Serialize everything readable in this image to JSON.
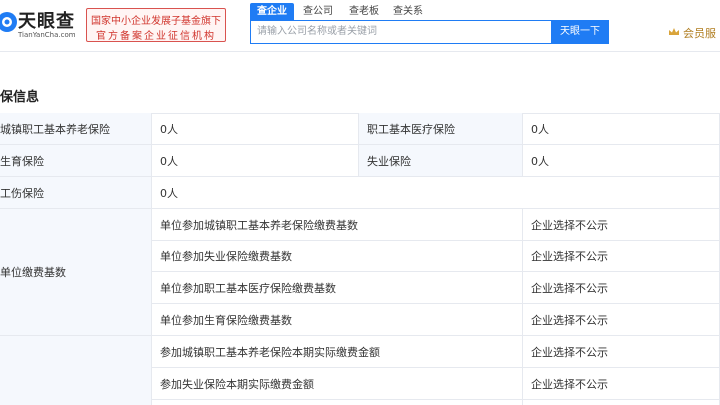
{
  "header": {
    "logo_text": "天眼查",
    "logo_subtext": "TianYanCha.com",
    "badge_line1": "国家中小企业发展子基金旗下",
    "badge_line2": "官方备案企业征信机构",
    "tabs": [
      "查企业",
      "查公司",
      "查老板",
      "查关系"
    ],
    "search_placeholder": "请输入公司名称或者关键词",
    "search_button": "天眼一下",
    "vip_label": "会员服",
    "accent_color": "#1f7cf4",
    "badge_color": "#d0342c"
  },
  "section": {
    "title": "保信息"
  },
  "table": {
    "row1": {
      "label1": "城镇职工基本养老保险",
      "value1": "0人",
      "label2": "职工基本医疗保险",
      "value2": "0人"
    },
    "row2": {
      "label1": "生育保险",
      "value1": "0人",
      "label2": "失业保险",
      "value2": "0人"
    },
    "row3": {
      "label1": "工伤保险",
      "value1": "0人"
    },
    "group1": {
      "label": "单位缴费基数",
      "items": [
        {
          "name": "单位参加城镇职工基本养老保险缴费基数",
          "value": "企业选择不公示"
        },
        {
          "name": "单位参加失业保险缴费基数",
          "value": "企业选择不公示"
        },
        {
          "name": "单位参加职工基本医疗保险缴费基数",
          "value": "企业选择不公示"
        },
        {
          "name": "单位参加生育保险缴费基数",
          "value": "企业选择不公示"
        }
      ]
    },
    "group2": {
      "items": [
        {
          "name": "参加城镇职工基本养老保险本期实际缴费金额",
          "value": "企业选择不公示"
        },
        {
          "name": "参加失业保险本期实际缴费金额",
          "value": "企业选择不公示"
        }
      ]
    }
  }
}
